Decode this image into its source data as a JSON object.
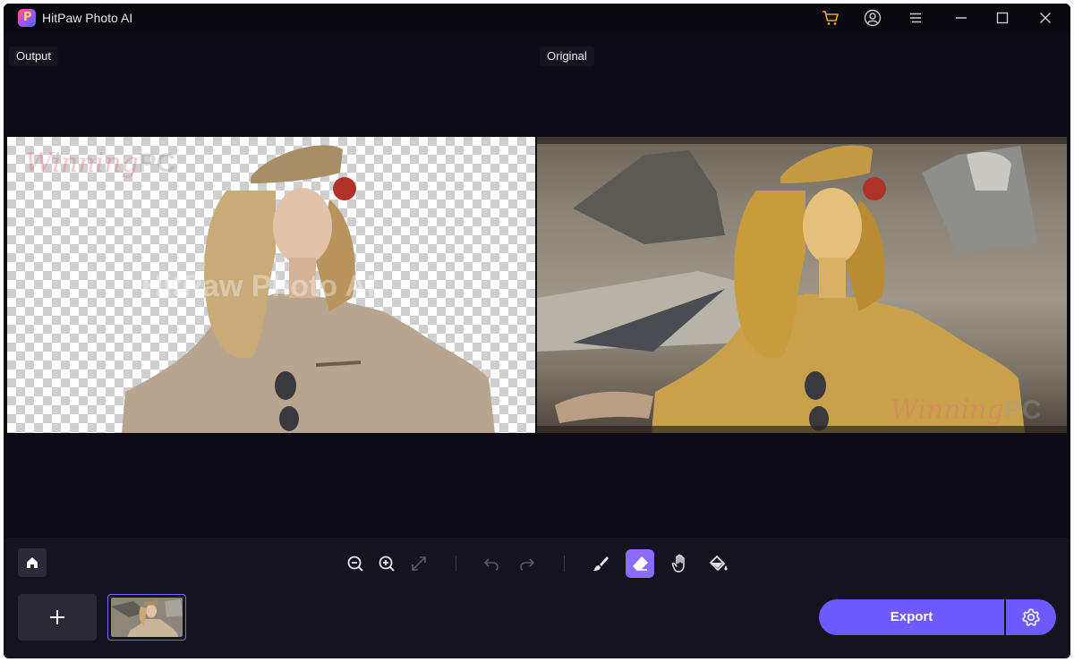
{
  "app": {
    "title": "HitPaw Photo AI",
    "logo_icon": "hitpaw-logo-icon"
  },
  "titlebar": {
    "icons": [
      "cart-icon",
      "account-icon",
      "menu-icon",
      "minimize-icon",
      "maximize-icon",
      "close-icon"
    ],
    "cart_color": "#f5a623"
  },
  "canvas": {
    "output_label": "Output",
    "original_label": "Original"
  },
  "image": {
    "watermark_left": "Winning",
    "watermark_right": "PC",
    "overlay_text": "HitPaw Photo AI"
  },
  "toolbar": {
    "home_icon": "home-icon",
    "tools": [
      "zoom-out-icon",
      "zoom-in-icon",
      "fit-icon",
      "undo-icon",
      "redo-icon",
      "brush-icon",
      "eraser-icon",
      "hand-icon",
      "fill-icon"
    ],
    "active_tool": "eraser-icon",
    "accent": "#8a6cff"
  },
  "footer": {
    "add_icon": "plus-icon",
    "export_label": "Export",
    "settings_icon": "gear-icon",
    "export_color": "#6e5bff"
  }
}
